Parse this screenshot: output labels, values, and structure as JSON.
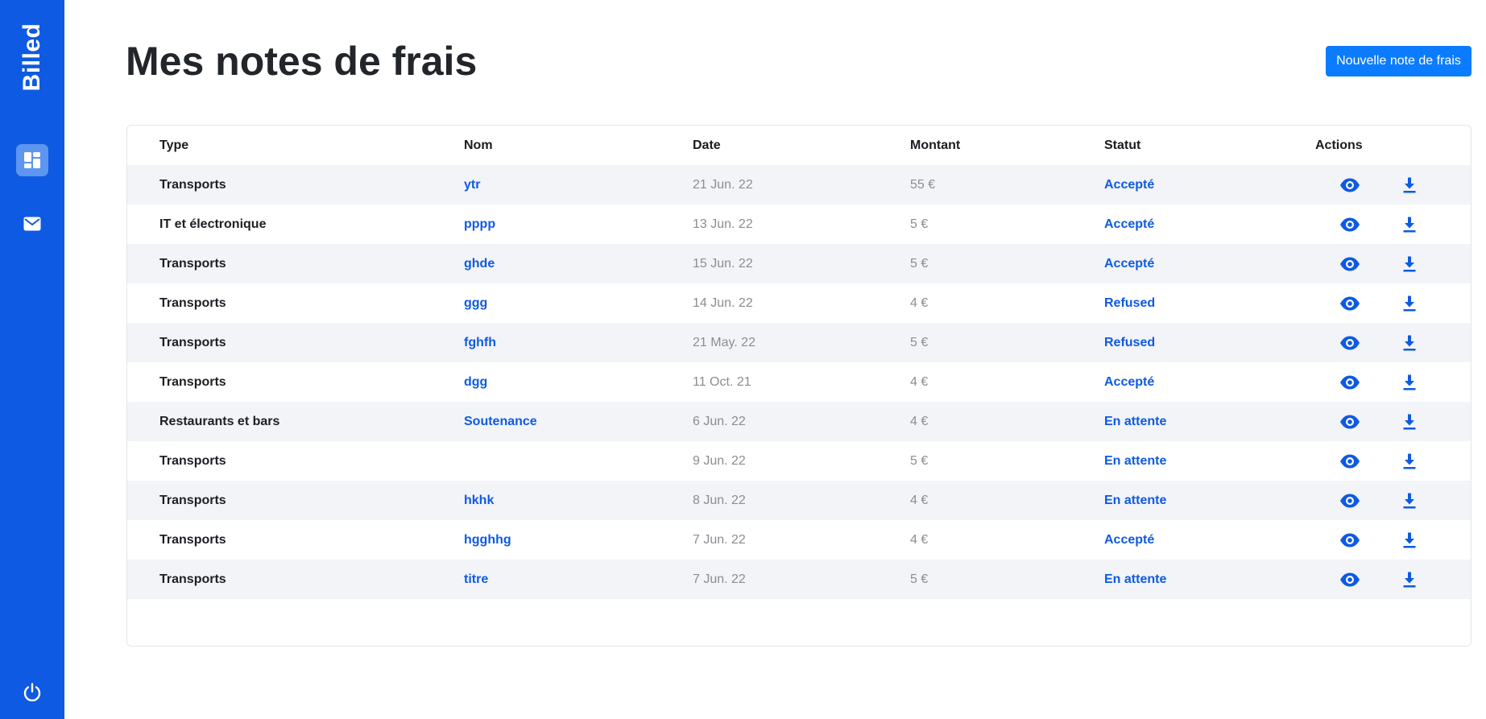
{
  "app": {
    "brand": "Billed"
  },
  "sidebar": {
    "items": [
      {
        "icon": "window-icon",
        "active": true
      },
      {
        "icon": "mail-icon",
        "active": false
      },
      {
        "icon": "power-icon",
        "active": false
      }
    ]
  },
  "header": {
    "title": "Mes notes de frais",
    "new_bill_label": "Nouvelle note de frais"
  },
  "table": {
    "columns": [
      "Type",
      "Nom",
      "Date",
      "Montant",
      "Statut",
      "Actions"
    ],
    "rows": [
      {
        "type": "Transports",
        "name": "ytr",
        "date": "21 Jun. 22",
        "amount": "55 €",
        "status": "Accepté"
      },
      {
        "type": "IT et électronique",
        "name": "pppp",
        "date": "13 Jun. 22",
        "amount": "5 €",
        "status": "Accepté"
      },
      {
        "type": "Transports",
        "name": "ghde",
        "date": "15 Jun. 22",
        "amount": "5 €",
        "status": "Accepté"
      },
      {
        "type": "Transports",
        "name": "ggg",
        "date": "14 Jun. 22",
        "amount": "4 €",
        "status": "Refused"
      },
      {
        "type": "Transports",
        "name": "fghfh",
        "date": "21 May. 22",
        "amount": "5 €",
        "status": "Refused"
      },
      {
        "type": "Transports",
        "name": "dgg",
        "date": "11 Oct. 21",
        "amount": "4 €",
        "status": "Accepté"
      },
      {
        "type": "Restaurants et bars",
        "name": "Soutenance",
        "date": "6 Jun. 22",
        "amount": "4 €",
        "status": "En attente"
      },
      {
        "type": "Transports",
        "name": "",
        "date": "9 Jun. 22",
        "amount": "5 €",
        "status": "En attente"
      },
      {
        "type": "Transports",
        "name": "hkhk",
        "date": "8 Jun. 22",
        "amount": "4 €",
        "status": "En attente"
      },
      {
        "type": "Transports",
        "name": "hgghhg",
        "date": "7 Jun. 22",
        "amount": "4 €",
        "status": "Accepté"
      },
      {
        "type": "Transports",
        "name": "titre",
        "date": "7 Jun. 22",
        "amount": "5 €",
        "status": "En attente"
      }
    ],
    "row_actions": [
      "eye-icon",
      "download-icon"
    ]
  },
  "colors": {
    "sidebar": "#0e5ae2",
    "accent_button": "#0b7cff",
    "link_text": "#0e5ae2",
    "stripe": "#f2f4f8"
  }
}
